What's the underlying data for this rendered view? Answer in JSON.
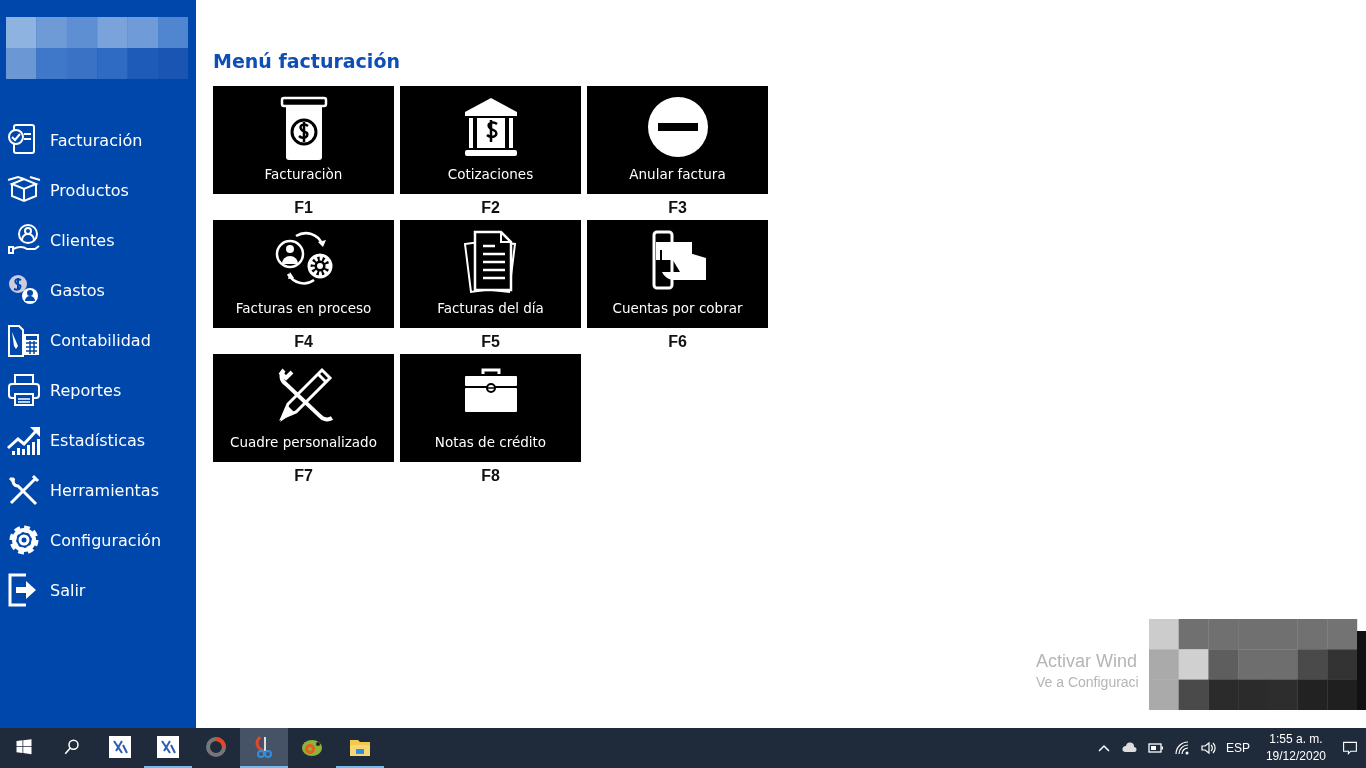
{
  "sidebar": {
    "items": [
      {
        "label": "Facturación"
      },
      {
        "label": "Productos"
      },
      {
        "label": "Clientes"
      },
      {
        "label": "Gastos"
      },
      {
        "label": "Contabilidad"
      },
      {
        "label": "Reportes"
      },
      {
        "label": "Estadísticas"
      },
      {
        "label": "Herramientas"
      },
      {
        "label": "Configuración"
      },
      {
        "label": "Salir"
      }
    ]
  },
  "main": {
    "title": "Menú facturación",
    "tiles": [
      {
        "label": "Facturaciòn",
        "key": "F1"
      },
      {
        "label": "Cotizaciones",
        "key": "F2"
      },
      {
        "label": "Anular factura",
        "key": "F3"
      },
      {
        "label": "Facturas en proceso",
        "key": "F4"
      },
      {
        "label": "Facturas del día",
        "key": "F5"
      },
      {
        "label": "Cuentas por cobrar",
        "key": "F6"
      },
      {
        "label": "Cuadre personalizado",
        "key": "F7"
      },
      {
        "label": "Notas de crédito",
        "key": "F8"
      }
    ]
  },
  "activation_notice": {
    "title": "Activar Wind",
    "subtitle": "Ve a Configuraci"
  },
  "taskbar": {
    "apps": [
      {
        "running": false,
        "selected": false
      },
      {
        "running": true,
        "selected": false
      },
      {
        "running": false,
        "selected": false
      },
      {
        "running": true,
        "selected": true
      },
      {
        "running": false,
        "selected": false
      },
      {
        "running": true,
        "selected": false
      }
    ],
    "language": "ESP",
    "time": "1:55 a. m.",
    "date": "19/12/2020"
  }
}
